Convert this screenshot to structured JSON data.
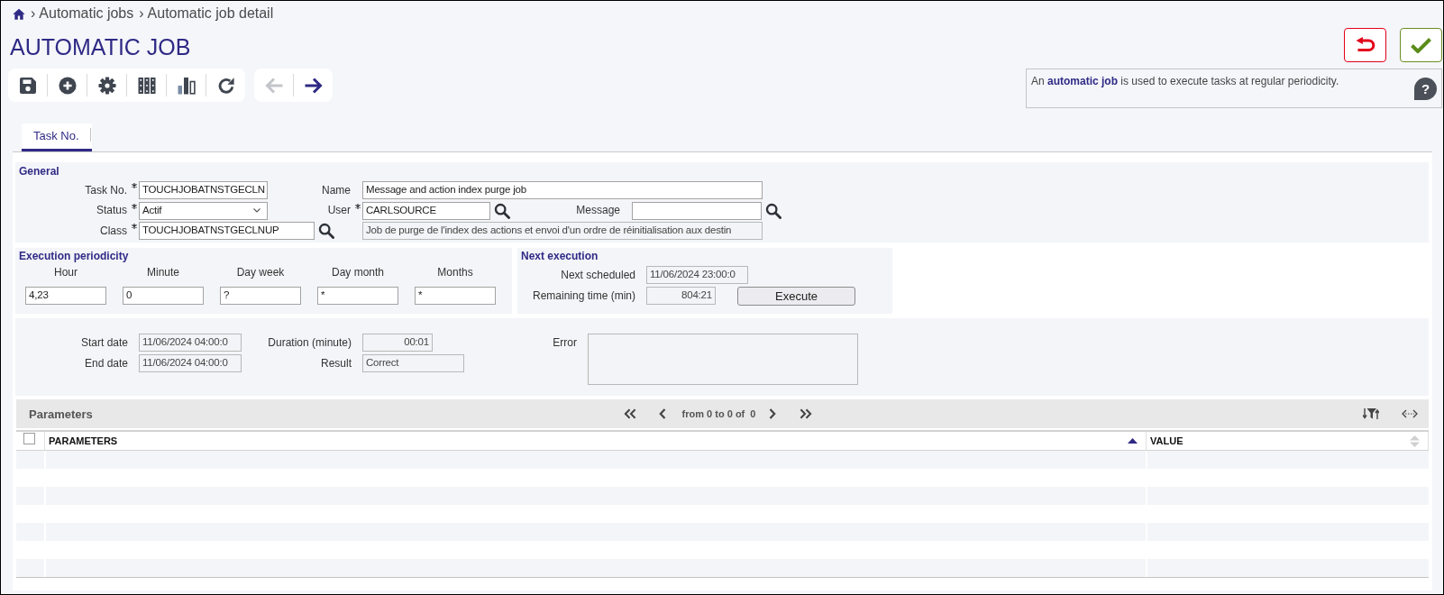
{
  "breadcrumb": [
    {
      "separator": "›",
      "label": "Automatic jobs"
    },
    {
      "separator": "›",
      "label": "Automatic job detail"
    }
  ],
  "title": "AUTOMATIC JOB",
  "toolbar": {
    "navigation": [
      {
        "kind": "previous",
        "disabled": true
      },
      {
        "kind": "next",
        "disabled": false
      }
    ]
  },
  "help": {
    "text": "An **automatic job** is used to execute tasks at regular periodicity.",
    "button": "?"
  },
  "tabs": [
    {
      "label": "Task No.",
      "selected": true
    }
  ],
  "general": {
    "title": "General",
    "fields": [
      {
        "label": "Task No.",
        "required": true,
        "kind": "text",
        "readonly": false,
        "value": "TOUCHJOBATNSTGECLN"
      },
      {
        "label": "Name",
        "required": false,
        "kind": "text",
        "readonly": false,
        "value": "Message and action index purge job"
      },
      {
        "label": "Status",
        "required": true,
        "kind": "select",
        "readonly": false,
        "value": "Actif"
      },
      {
        "label": "User",
        "required": true,
        "kind": "lookup",
        "readonly": false,
        "value": "CARLSOURCE"
      },
      {
        "label": "Message",
        "required": false,
        "kind": "lookup",
        "readonly": false
      },
      {
        "label": "Class",
        "required": true,
        "kind": "lookup",
        "readonly": false,
        "value": "TOUCHJOBATNSTGECLNUP"
      },
      {
        "required": false,
        "kind": "text",
        "readonly": true,
        "value": "Job de purge de l'index des actions et envoi d'un ordre de réinitialisation aux destin"
      }
    ]
  },
  "execution_periodicity": {
    "title": "Execution periodicity",
    "fields": [
      {
        "label": "Hour",
        "kind": "text",
        "readonly": false,
        "value": "4,23"
      },
      {
        "label": "Minute",
        "kind": "text",
        "readonly": false,
        "value": "0"
      },
      {
        "label": "Day week",
        "kind": "text",
        "readonly": false,
        "value": "?"
      },
      {
        "label": "Day month",
        "kind": "text",
        "readonly": false,
        "value": "*"
      },
      {
        "label": "Months",
        "kind": "text",
        "readonly": false,
        "value": "*"
      }
    ]
  },
  "next_execution": {
    "title": "Next execution",
    "fields": [
      {
        "label": "Next scheduled",
        "kind": "text",
        "readonly": true,
        "value": "11/06/2024 23:00:0"
      },
      {
        "label": "Remaining time (min)",
        "kind": "number",
        "readonly": true,
        "value": "804:21"
      }
    ],
    "button": "Execute"
  },
  "last_run": {
    "fields": [
      {
        "label": "Start date",
        "kind": "text",
        "readonly": true,
        "value": "11/06/2024 04:00:0"
      },
      {
        "label": "End date",
        "kind": "text",
        "readonly": true,
        "value": "11/06/2024 04:00:0"
      },
      {
        "label": "Duration (minute)",
        "kind": "number",
        "readonly": true,
        "value": "00:01"
      },
      {
        "label": "Result",
        "kind": "text",
        "readonly": true,
        "value": "Correct"
      },
      {
        "label": "Error",
        "kind": "textarea",
        "readonly": true
      }
    ]
  },
  "parameters": {
    "title": "Parameters",
    "pagination": {
      "range": "from 0 to 0 of",
      "total": "0"
    },
    "table": {
      "select_all": {
        "checked": false
      },
      "columns": [
        {
          "label": "PARAMETERS",
          "sorted": true
        },
        {
          "label": "VALUE",
          "sorted": false
        }
      ]
    }
  }
}
